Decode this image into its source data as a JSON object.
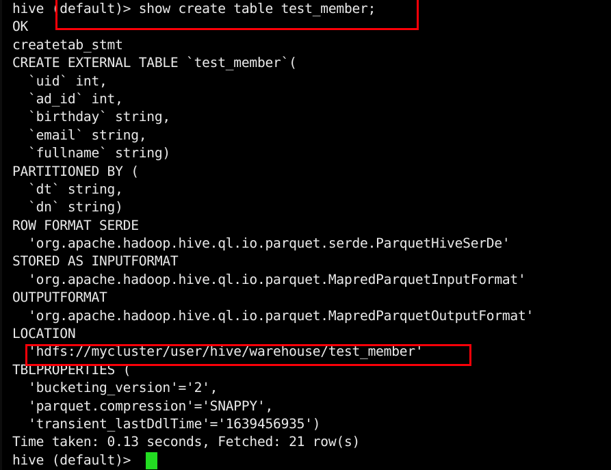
{
  "terminal": {
    "app": "hive-cli",
    "background_color": "#000000",
    "text_color": "#e9e9e9",
    "annotation_color": "#fb0008",
    "cursor_color": "#23dd22",
    "prompt": "hive (default)>",
    "command": "show create table test_member;",
    "lines": [
      "hive (default)> show create table test_member;",
      "OK",
      "createtab_stmt",
      "CREATE EXTERNAL TABLE `test_member`(",
      "  `uid` int,",
      "  `ad_id` int,",
      "  `birthday` string,",
      "  `email` string,",
      "  `fullname` string)",
      "PARTITIONED BY (",
      "  `dt` string,",
      "  `dn` string)",
      "ROW FORMAT SERDE",
      "  'org.apache.hadoop.hive.ql.io.parquet.serde.ParquetHiveSerDe'",
      "STORED AS INPUTFORMAT",
      "  'org.apache.hadoop.hive.ql.io.parquet.MapredParquetInputFormat'",
      "OUTPUTFORMAT",
      "  'org.apache.hadoop.hive.ql.io.parquet.MapredParquetOutputFormat'",
      "LOCATION",
      "  'hdfs://mycluster/user/hive/warehouse/test_member'",
      "TBLPROPERTIES (",
      "  'bucketing_version'='2',",
      "  'parquet.compression'='SNAPPY',",
      "  'transient_lastDdlTime'='1639456935')",
      "Time taken: 0.13 seconds, Fetched: 21 row(s)",
      "hive (default)> "
    ],
    "status": {
      "ok": "OK",
      "result_header": "createtab_stmt",
      "time_taken": "0.13",
      "fetched_rows": "21",
      "timing_line": "Time taken: 0.13 seconds, Fetched: 21 row(s)"
    },
    "table": {
      "name": "test_member",
      "type": "CREATE EXTERNAL TABLE",
      "columns": [
        {
          "name": "uid",
          "type": "int"
        },
        {
          "name": "ad_id",
          "type": "int"
        },
        {
          "name": "birthday",
          "type": "string"
        },
        {
          "name": "email",
          "type": "string"
        },
        {
          "name": "fullname",
          "type": "string"
        }
      ],
      "partitions": [
        {
          "name": "dt",
          "type": "string"
        },
        {
          "name": "dn",
          "type": "string"
        }
      ],
      "row_format_serde": "org.apache.hadoop.hive.ql.io.parquet.serde.ParquetHiveSerDe",
      "input_format": "org.apache.hadoop.hive.ql.io.parquet.MapredParquetInputFormat",
      "output_format": "org.apache.hadoop.hive.ql.io.parquet.MapredParquetOutputFormat",
      "location": "hdfs://mycluster/user/hive/warehouse/test_member",
      "tblproperties": [
        {
          "key": "bucketing_version",
          "value": "2"
        },
        {
          "key": "parquet.compression",
          "value": "SNAPPY"
        },
        {
          "key": "transient_lastDdlTime",
          "value": "1639456935"
        }
      ]
    },
    "annotations": [
      {
        "label": "command-highlight",
        "target": "show create table test_member;"
      },
      {
        "label": "location-highlight",
        "target": "'hdfs://mycluster/user/hive/warehouse/test_member'"
      }
    ]
  }
}
